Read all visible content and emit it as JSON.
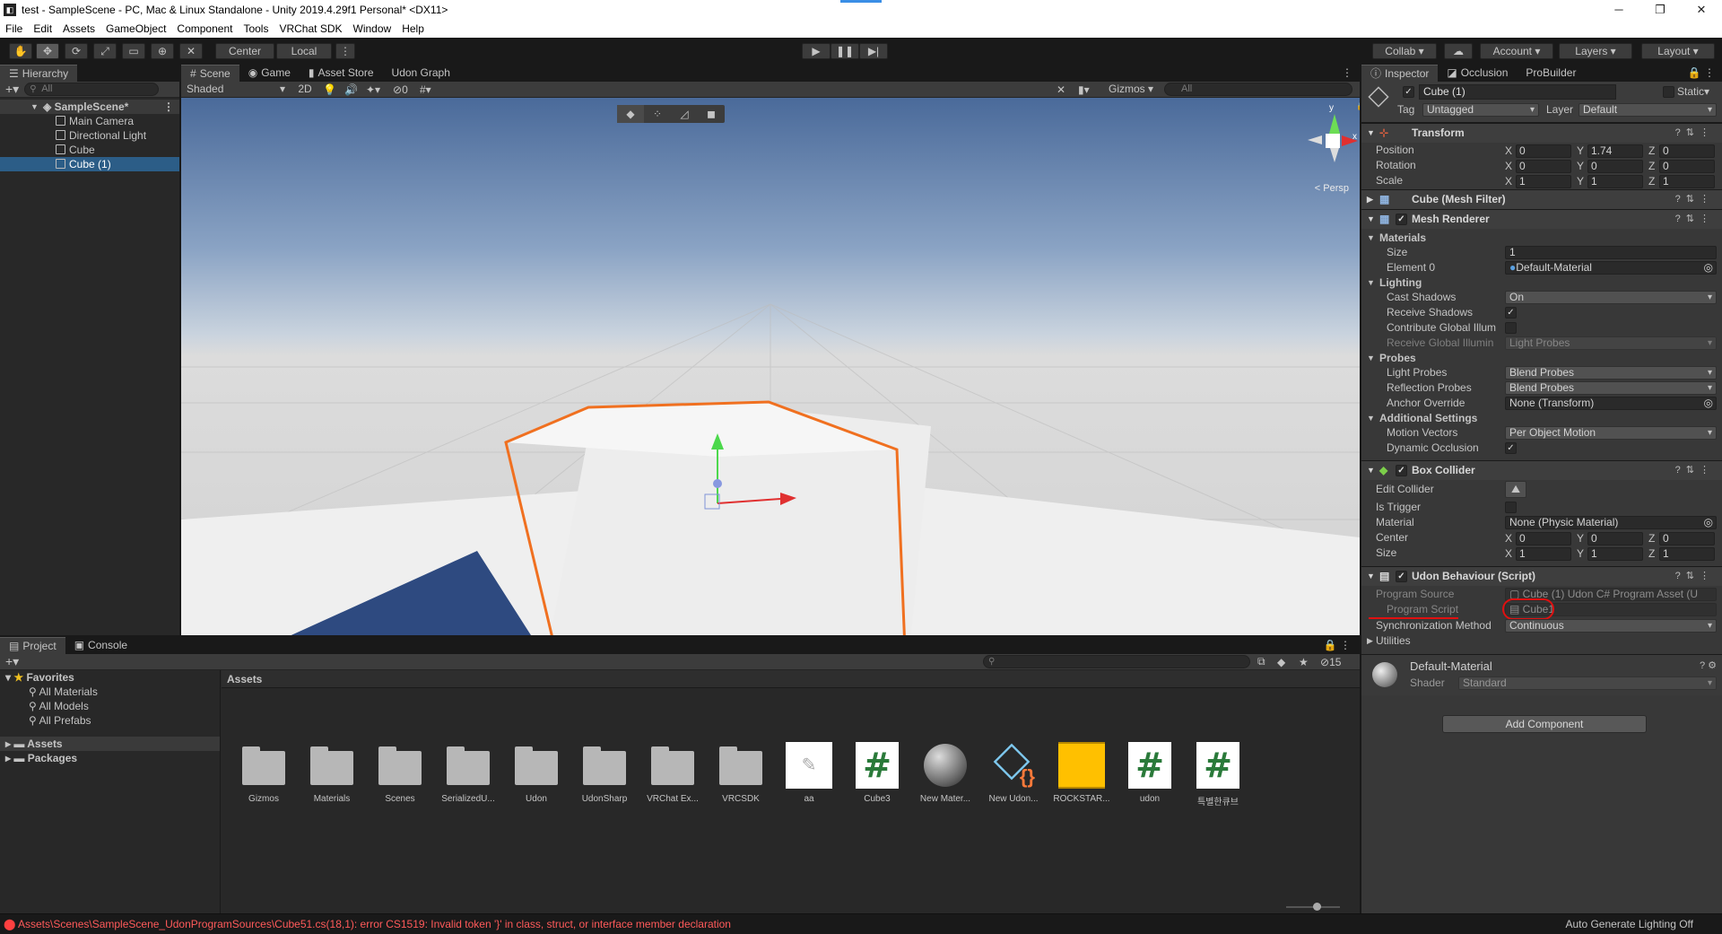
{
  "window": {
    "title": "test - SampleScene - PC, Mac & Linux Standalone - Unity 2019.4.29f1 Personal* <DX11>",
    "minimize": "─",
    "maximize": "❐",
    "close": "✕"
  },
  "menu": [
    "File",
    "Edit",
    "Assets",
    "GameObject",
    "Component",
    "Tools",
    "VRChat SDK",
    "Window",
    "Help"
  ],
  "toolbar": {
    "pivot": "Center",
    "space": "Local",
    "collab": "Collab ▾",
    "account": "Account",
    "layers": "Layers",
    "layout": "Layout"
  },
  "hierarchy": {
    "tab": "Hierarchy",
    "search_placeholder": "All",
    "scene": "SampleScene*",
    "items": [
      "Main Camera",
      "Directional Light",
      "Cube",
      "Cube (1)"
    ]
  },
  "scene_view": {
    "tabs": [
      "Scene",
      "Game",
      "Asset Store",
      "Udon Graph"
    ],
    "shading": "Shaded",
    "mode_2d": "2D",
    "hidden_count": "0",
    "gizmos": "Gizmos",
    "search_placeholder": "All",
    "persp": "Persp",
    "axis_y": "y",
    "axis_x": "x"
  },
  "project": {
    "tabs": [
      "Project",
      "Console"
    ],
    "favorites_label": "Favorites",
    "favorites": [
      "All Materials",
      "All Models",
      "All Prefabs"
    ],
    "roots": [
      "Assets",
      "Packages"
    ],
    "breadcrumb": "Assets",
    "hidden_count": "15",
    "assets": [
      {
        "name": "Gizmos",
        "kind": "folder"
      },
      {
        "name": "Materials",
        "kind": "folder"
      },
      {
        "name": "Scenes",
        "kind": "folder"
      },
      {
        "name": "SerializedU...",
        "kind": "folder"
      },
      {
        "name": "Udon",
        "kind": "folder"
      },
      {
        "name": "UdonSharp",
        "kind": "folder"
      },
      {
        "name": "VRChat Ex...",
        "kind": "folder"
      },
      {
        "name": "VRCSDK",
        "kind": "folder"
      },
      {
        "name": "aa",
        "kind": "image"
      },
      {
        "name": "Cube3",
        "kind": "script"
      },
      {
        "name": "New Mater...",
        "kind": "material"
      },
      {
        "name": "New Udon...",
        "kind": "udon"
      },
      {
        "name": "ROCKSTAR...",
        "kind": "texture"
      },
      {
        "name": "udon",
        "kind": "script"
      },
      {
        "name": "특별한큐브",
        "kind": "script"
      }
    ]
  },
  "inspector": {
    "tabs": [
      "Inspector",
      "Occlusion",
      "ProBuilder"
    ],
    "object_name": "Cube (1)",
    "static_label": "Static",
    "tag_label": "Tag",
    "tag_value": "Untagged",
    "layer_label": "Layer",
    "layer_value": "Default",
    "transform": {
      "title": "Transform",
      "rows": [
        {
          "label": "Position",
          "x": "0",
          "y": "1.74",
          "z": "0"
        },
        {
          "label": "Rotation",
          "x": "0",
          "y": "0",
          "z": "0"
        },
        {
          "label": "Scale",
          "x": "1",
          "y": "1",
          "z": "1"
        }
      ]
    },
    "mesh_filter": {
      "title": "Cube (Mesh Filter)"
    },
    "mesh_renderer": {
      "title": "Mesh Renderer",
      "materials": "Materials",
      "size_label": "Size",
      "size_value": "1",
      "element0_label": "Element 0",
      "element0_value": "Default-Material",
      "lighting": "Lighting",
      "cast_shadows_label": "Cast Shadows",
      "cast_shadows_value": "On",
      "receive_shadows_label": "Receive Shadows",
      "contribute_gi_label": "Contribute Global Illum",
      "receive_gi_label": "Receive Global Illumin",
      "receive_gi_value": "Light Probes",
      "probes": "Probes",
      "light_probes_label": "Light Probes",
      "light_probes_value": "Blend Probes",
      "reflection_probes_label": "Reflection Probes",
      "reflection_probes_value": "Blend Probes",
      "anchor_override_label": "Anchor Override",
      "anchor_override_value": "None (Transform)",
      "additional": "Additional Settings",
      "motion_vectors_label": "Motion Vectors",
      "motion_vectors_value": "Per Object Motion",
      "dynamic_occlusion_label": "Dynamic Occlusion"
    },
    "box_collider": {
      "title": "Box Collider",
      "edit_label": "Edit Collider",
      "trigger_label": "Is Trigger",
      "material_label": "Material",
      "material_value": "None (Physic Material)",
      "center_label": "Center",
      "center": {
        "x": "0",
        "y": "0",
        "z": "0"
      },
      "size_label": "Size",
      "size": {
        "x": "1",
        "y": "1",
        "z": "1"
      }
    },
    "udon": {
      "title": "Udon Behaviour (Script)",
      "program_source_label": "Program Source",
      "program_source_value": "Cube (1) Udon C# Program Asset (U",
      "program_script_label": "Program Script",
      "program_script_value": "Cube1",
      "sync_label": "Synchronization Method",
      "sync_value": "Continuous",
      "utilities": "Utilities"
    },
    "material": {
      "name": "Default-Material",
      "shader_label": "Shader",
      "shader_value": "Standard"
    },
    "add_component": "Add Component"
  },
  "status": {
    "error": "Assets\\Scenes\\SampleScene_UdonProgramSources\\Cube51.cs(18,1): error CS1519: Invalid token '}' in class, struct, or interface member declaration",
    "lighting": "Auto Generate Lighting Off"
  },
  "colors": {
    "selection": "#2c5d87",
    "outline": "#f07020",
    "error": "#ff5a5a",
    "annotation": "#e01010"
  }
}
